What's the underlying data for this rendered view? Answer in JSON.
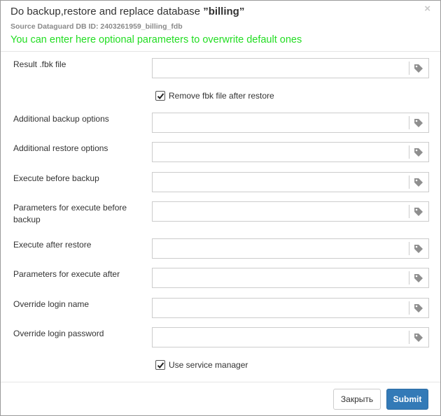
{
  "dialog": {
    "title_prefix": "Do backup,restore and replace database ",
    "title_db": "”billing”",
    "subtitle": "Source Dataguard DB ID: 2403261959_billing_fdb",
    "notice": "You can enter here optional parameters to overwrite default ones",
    "close_symbol": "×"
  },
  "fields": [
    {
      "label": "Result .fbk file",
      "value": "",
      "icon": "tag-icon"
    },
    {
      "label": "Additional backup options",
      "value": "",
      "icon": "tag-icon"
    },
    {
      "label": "Additional restore options",
      "value": "",
      "icon": "tag-icon"
    },
    {
      "label": "Execute before backup",
      "value": "",
      "icon": "tag-icon"
    },
    {
      "label": "Parameters for execute before backup",
      "value": "",
      "icon": "tag-icon"
    },
    {
      "label": "Execute after restore",
      "value": "",
      "icon": "tag-icon"
    },
    {
      "label": "Parameters for execute after",
      "value": "",
      "icon": "tag-icon"
    },
    {
      "label": "Override login name",
      "value": "",
      "icon": "tag-icon"
    },
    {
      "label": "Override login password",
      "value": "",
      "icon": "tag-icon"
    }
  ],
  "checkboxes": {
    "remove_fbk": {
      "label": "Remove fbk file after restore",
      "checked": true
    },
    "service_manager": {
      "label": "Use service manager",
      "checked": true
    }
  },
  "footer": {
    "close_label": "Закрыть",
    "submit_label": "Submit"
  },
  "colors": {
    "notice": "#22dd22",
    "submit_bg": "#337ab7"
  }
}
